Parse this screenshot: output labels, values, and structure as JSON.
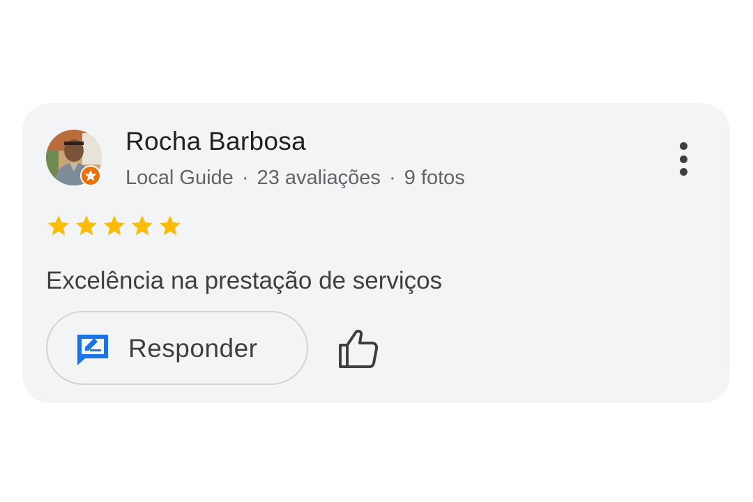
{
  "review": {
    "author_name": "Rocha Barbosa",
    "author_badge": "Local Guide",
    "review_count": "23 avaliações",
    "photo_count": "9 fotos",
    "separator": "·",
    "rating": 5,
    "rating_max": 5,
    "text": "Excelência na prestação de serviços"
  },
  "actions": {
    "reply_label": "Responder",
    "reply_icon": "edit-reply-icon",
    "like_icon": "thumbs-up-icon",
    "more_icon": "more-vertical-icon"
  },
  "colors": {
    "card_background": "#f3f4f6",
    "star": "#fbbc04",
    "reply_icon": "#1a73e8",
    "guide_badge": "#e8710a"
  }
}
